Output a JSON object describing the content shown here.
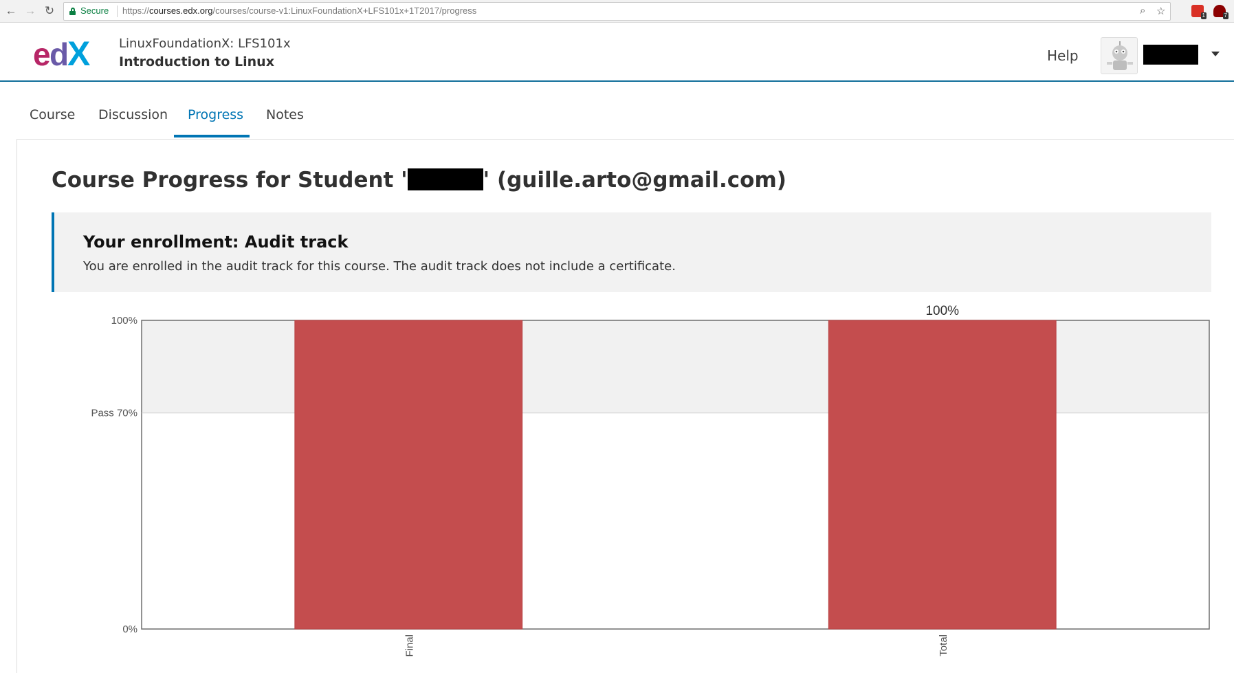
{
  "browser": {
    "secure_label": "Secure",
    "url_prefix": "https://",
    "url_host": "courses.edx.org",
    "url_path": "/courses/course-v1:LinuxFoundationX+LFS101x+1T2017/progress",
    "extensions": [
      {
        "name": "gmail-extension",
        "color": "#d93025",
        "badge": "1"
      },
      {
        "name": "ublock-extension",
        "color": "#a00",
        "badge": "7"
      }
    ]
  },
  "header": {
    "logo_text": "edX",
    "course_org": "LinuxFoundationX: LFS101x",
    "course_title": "Introduction to Linux",
    "help_label": "Help",
    "username": "[redacted]"
  },
  "tabs": [
    {
      "label": "Course",
      "active": false
    },
    {
      "label": "Discussion",
      "active": false
    },
    {
      "label": "Progress",
      "active": true
    },
    {
      "label": "Notes",
      "active": false
    }
  ],
  "page": {
    "title_prefix": "Course Progress for Student '",
    "title_suffix": "' (guille.arto@gmail.com)",
    "student_name": "[redacted]"
  },
  "enrollment": {
    "title": "Your enrollment: Audit track",
    "message": "You are enrolled in the audit track for this course. The audit track does not include a certificate."
  },
  "chart_data": {
    "type": "bar",
    "categories": [
      "Final",
      "Total"
    ],
    "values": [
      100,
      100
    ],
    "value_labels": [
      "",
      "100%"
    ],
    "ylim": [
      0,
      100
    ],
    "pass_threshold": 70,
    "y_ticks": [
      {
        "value": 0,
        "label": "0%"
      },
      {
        "value": 70,
        "label": "Pass 70%"
      },
      {
        "value": 100,
        "label": "100%"
      }
    ],
    "bar_color": "#c44d4e",
    "pass_band_color": "#f1f1f1",
    "grid": false,
    "xlabel": "",
    "ylabel": "",
    "title": ""
  }
}
